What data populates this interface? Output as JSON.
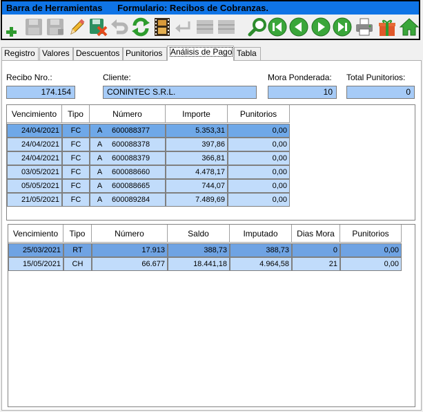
{
  "toolbar": {
    "title_left": "Barra de Herramientas",
    "title_right": "Formulario: Recibos de Cobranzas.",
    "buttons": [
      {
        "name": "new-record-icon",
        "enabled": true
      },
      {
        "name": "save-icon",
        "enabled": false
      },
      {
        "name": "save-as-icon",
        "enabled": false
      },
      {
        "name": "edit-pencil-icon",
        "enabled": true
      },
      {
        "name": "delete-record-icon",
        "enabled": true
      },
      {
        "name": "undo-icon",
        "enabled": false
      },
      {
        "name": "refresh-icon",
        "enabled": true
      },
      {
        "name": "film-icon",
        "enabled": true
      },
      {
        "name": "return-icon",
        "enabled": false
      },
      {
        "name": "grid-icon",
        "enabled": false
      },
      {
        "name": "grid-alt-icon",
        "enabled": false
      },
      {
        "name": "search-icon",
        "enabled": true
      },
      {
        "name": "first-record-icon",
        "enabled": true
      },
      {
        "name": "previous-record-icon",
        "enabled": true
      },
      {
        "name": "next-record-icon",
        "enabled": true
      },
      {
        "name": "last-record-icon",
        "enabled": true
      },
      {
        "name": "print-icon",
        "enabled": true
      },
      {
        "name": "gift-icon",
        "enabled": true
      },
      {
        "name": "home-icon",
        "enabled": true
      }
    ],
    "colors": {
      "title_bg": "#0f74e6",
      "field_bg": "#a6cbf7"
    }
  },
  "tabs": [
    {
      "label": "Registro",
      "active": false
    },
    {
      "label": "Valores",
      "active": false
    },
    {
      "label": "Descuentos",
      "active": false
    },
    {
      "label": "Punitorios",
      "active": false
    },
    {
      "label": "Análisis de Pago",
      "active": true
    },
    {
      "label": "Tabla",
      "active": false
    }
  ],
  "header": {
    "recibo_label": "Recibo Nro.:",
    "recibo_value": "174.154",
    "cliente_label": "Cliente:",
    "cliente_value": "CONINTEC S.R.L.",
    "mora_label": "Mora Ponderada:",
    "mora_value": "10",
    "punitorios_label": "Total Punitorios:",
    "punitorios_value": "0"
  },
  "comprobantes": {
    "columns": [
      "Vencimiento",
      "Tipo",
      "Número",
      "Importe",
      "Punitorios"
    ],
    "rows": [
      {
        "vencimiento": "24/04/2021",
        "tipo": "FC",
        "letra": "A",
        "numero": "600088377",
        "importe": "5.353,31",
        "punitorios": "0,00",
        "selected": true
      },
      {
        "vencimiento": "24/04/2021",
        "tipo": "FC",
        "letra": "A",
        "numero": "600088378",
        "importe": "397,86",
        "punitorios": "0,00",
        "selected": false
      },
      {
        "vencimiento": "24/04/2021",
        "tipo": "FC",
        "letra": "A",
        "numero": "600088379",
        "importe": "366,81",
        "punitorios": "0,00",
        "selected": false
      },
      {
        "vencimiento": "03/05/2021",
        "tipo": "FC",
        "letra": "A",
        "numero": "600088660",
        "importe": "4.478,17",
        "punitorios": "0,00",
        "selected": false
      },
      {
        "vencimiento": "05/05/2021",
        "tipo": "FC",
        "letra": "A",
        "numero": "600088665",
        "importe": "744,07",
        "punitorios": "0,00",
        "selected": false
      },
      {
        "vencimiento": "21/05/2021",
        "tipo": "FC",
        "letra": "A",
        "numero": "600089284",
        "importe": "7.489,69",
        "punitorios": "0,00",
        "selected": false
      }
    ]
  },
  "valores": {
    "columns": [
      "Vencimiento",
      "Tipo",
      "Número",
      "Saldo",
      "Imputado",
      "Dias Mora",
      "Punitorios"
    ],
    "rows": [
      {
        "vencimiento": "25/03/2021",
        "tipo": "RT",
        "numero": "17.913",
        "saldo": "388,73",
        "imputado": "388,73",
        "dias_mora": "0",
        "punitorios": "0,00",
        "selected": true
      },
      {
        "vencimiento": "15/05/2021",
        "tipo": "CH",
        "numero": "66.677",
        "saldo": "18.441,18",
        "imputado": "4.964,58",
        "dias_mora": "21",
        "punitorios": "0,00",
        "selected": false
      }
    ]
  }
}
